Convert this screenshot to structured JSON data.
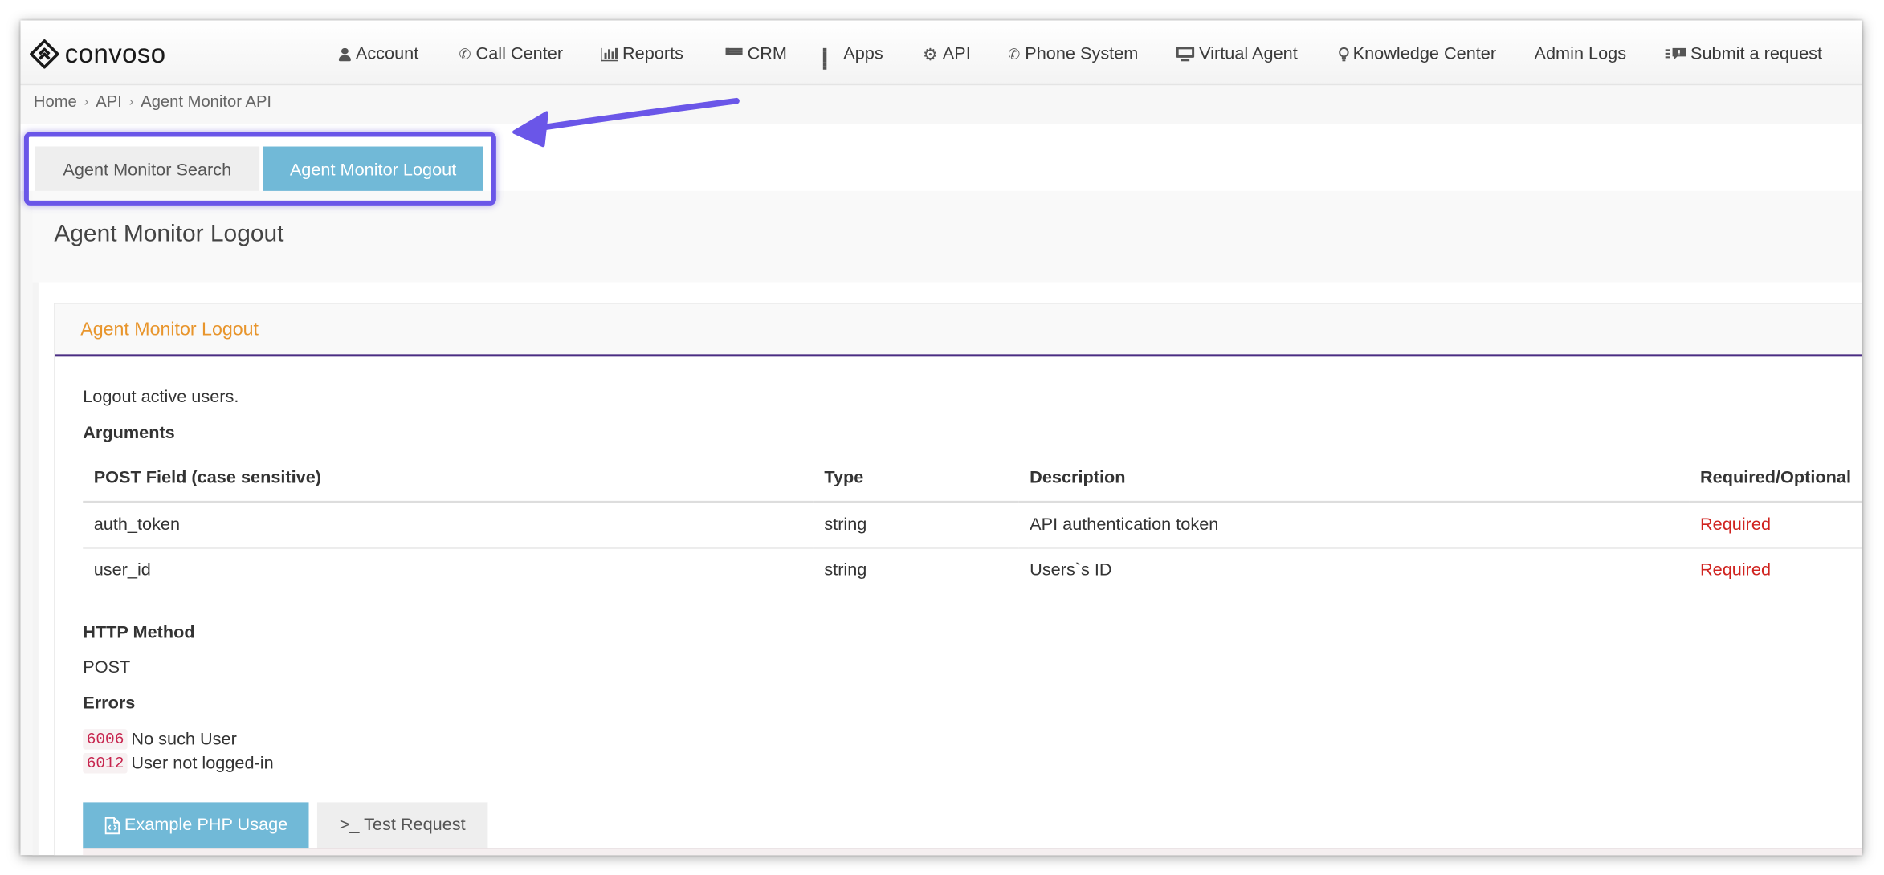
{
  "brand": {
    "name": "convoso"
  },
  "nav": [
    {
      "label": "Account",
      "icon": "user-icon"
    },
    {
      "label": "Call Center",
      "icon": "phone-icon"
    },
    {
      "label": "Reports",
      "icon": "bar-chart-icon"
    },
    {
      "label": "CRM",
      "icon": "list-icon"
    },
    {
      "label": "Apps",
      "icon": "grid-icon"
    },
    {
      "label": "API",
      "icon": "gear-icon"
    },
    {
      "label": "Phone System",
      "icon": "phone-icon"
    },
    {
      "label": "Virtual Agent",
      "icon": "monitor-icon"
    },
    {
      "label": "Knowledge Center",
      "icon": "lightbulb-icon"
    },
    {
      "label": "Admin Logs",
      "icon": ""
    },
    {
      "label": "Submit a request",
      "icon": "comment-icon"
    }
  ],
  "breadcrumb": [
    "Home",
    "API",
    "Agent Monitor API"
  ],
  "tabs": [
    {
      "label": "Agent Monitor Search",
      "active": false
    },
    {
      "label": "Agent Monitor Logout",
      "active": true
    }
  ],
  "page": {
    "title": "Agent Monitor Logout"
  },
  "panel": {
    "title": "Agent Monitor Logout",
    "description": "Logout active users.",
    "arguments_label": "Arguments",
    "table": {
      "headers": [
        "POST Field (case sensitive)",
        "Type",
        "Description",
        "Required/Optional"
      ],
      "rows": [
        [
          "auth_token",
          "string",
          "API authentication token",
          "Required"
        ],
        [
          "user_id",
          "string",
          "Users`s ID",
          "Required"
        ]
      ]
    },
    "http_method_label": "HTTP Method",
    "http_method": "POST",
    "errors_label": "Errors",
    "errors": [
      {
        "code": "6006",
        "message": "No such User"
      },
      {
        "code": "6012",
        "message": "User not logged-in"
      }
    ],
    "buttons": {
      "php_label": "Example PHP Usage",
      "test_label": ">_ Test Request"
    }
  },
  "colors": {
    "accent": "#71b9d7",
    "highlight": "#6a56e8",
    "panel_title": "#e8952c",
    "required": "#d0231f",
    "panel_rule": "#4a2d83"
  }
}
